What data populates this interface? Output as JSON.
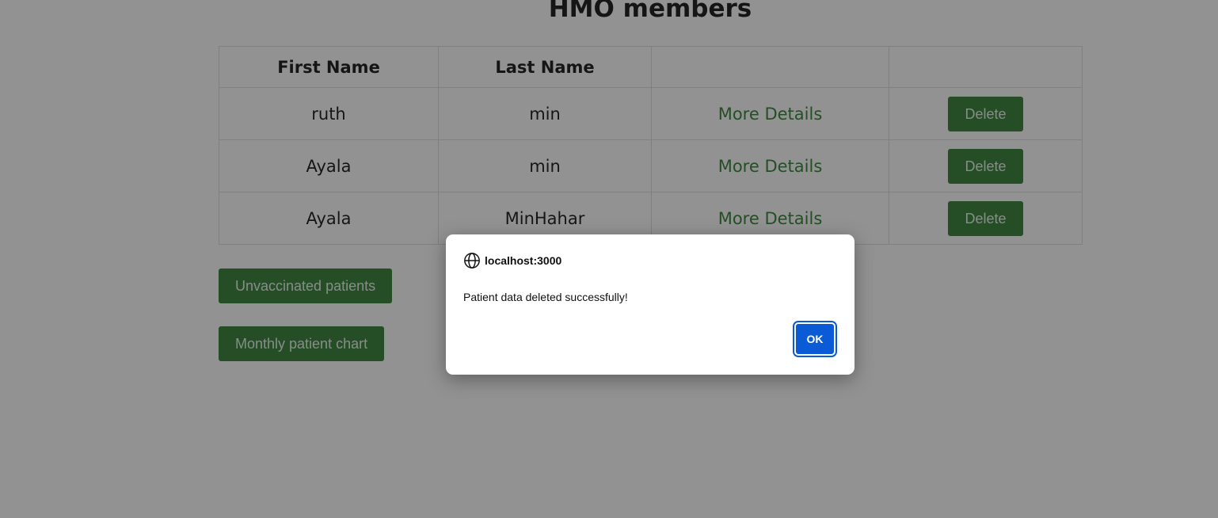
{
  "page": {
    "title": "HMO members"
  },
  "table": {
    "headers": [
      "First Name",
      "Last Name",
      "",
      ""
    ],
    "rows": [
      {
        "first": "ruth",
        "last": "min",
        "details": "More Details",
        "delete": "Delete"
      },
      {
        "first": "Ayala",
        "last": "min",
        "details": "More Details",
        "delete": "Delete"
      },
      {
        "first": "Ayala",
        "last": "MinHahar",
        "details": "More Details",
        "delete": "Delete"
      }
    ]
  },
  "actions": {
    "unvaccinated": "Unvaccinated patients",
    "monthly_chart": "Monthly patient chart"
  },
  "dialog": {
    "origin": "localhost:3000",
    "message": "Patient data deleted successfully!",
    "ok": "OK"
  },
  "colors": {
    "accent_green": "#2e7d32",
    "dialog_button": "#0b5ad6"
  }
}
